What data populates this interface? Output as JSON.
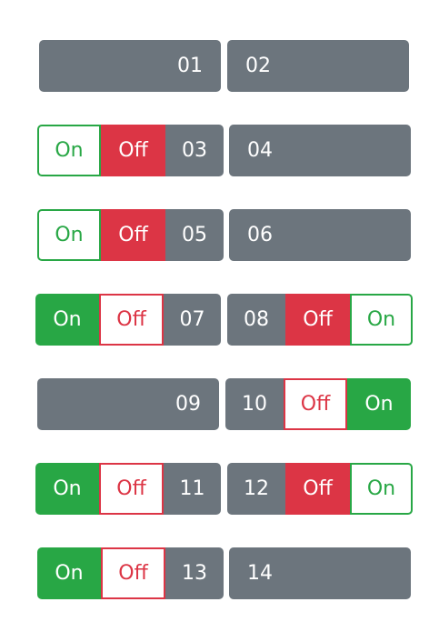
{
  "toggle": {
    "on": "On",
    "off": "Off"
  },
  "labels": {
    "01": "01",
    "02": "02",
    "03": "03",
    "04": "04",
    "05": "05",
    "06": "06",
    "07": "07",
    "08": "08",
    "09": "09",
    "10": "10",
    "11": "11",
    "12": "12",
    "13": "13",
    "14": "14"
  },
  "colors": {
    "gray": "#6c757d",
    "success": "#28a745",
    "danger": "#dc3545"
  }
}
